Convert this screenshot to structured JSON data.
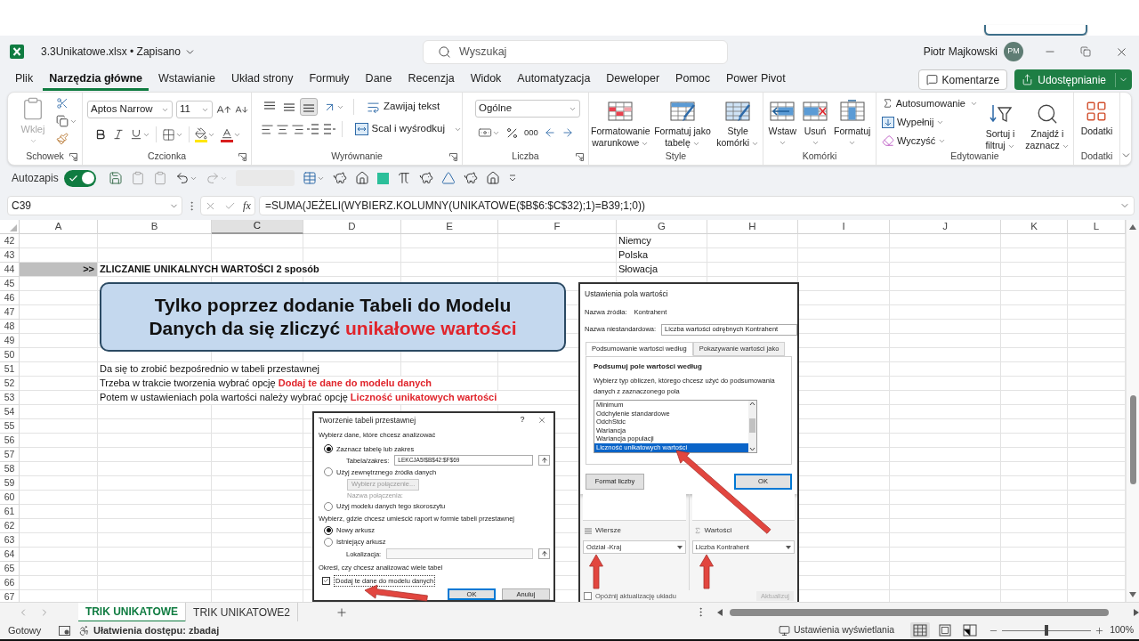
{
  "window": {
    "title": "3.3Unikatowe.xlsx • Zapisano",
    "user_name": "Piotr Majkowski",
    "user_initials": "PM"
  },
  "search": {
    "placeholder": "Wyszukaj"
  },
  "menu_tabs": [
    {
      "label": "Plik",
      "selected": false
    },
    {
      "label": "Narzędzia główne",
      "selected": true
    },
    {
      "label": "Wstawianie",
      "selected": false
    },
    {
      "label": "Układ strony",
      "selected": false
    },
    {
      "label": "Formuły",
      "selected": false
    },
    {
      "label": "Dane",
      "selected": false
    },
    {
      "label": "Recenzja",
      "selected": false
    },
    {
      "label": "Widok",
      "selected": false
    },
    {
      "label": "Automatyzacja",
      "selected": false
    },
    {
      "label": "Deweloper",
      "selected": false
    },
    {
      "label": "Pomoc",
      "selected": false
    },
    {
      "label": "Power Pivot",
      "selected": false
    }
  ],
  "header_buttons": {
    "comments": "Komentarze",
    "share": "Udostępnianie"
  },
  "ribbon": {
    "clipboard": {
      "title": "Schowek",
      "paste": "Wklej",
      "paste_disabled": true
    },
    "font": {
      "title": "Czcionka",
      "family": "Aptos Narrow",
      "size": "11"
    },
    "alignment": {
      "title": "Wyrównanie",
      "wrap_text": "Zawijaj tekst",
      "merge": "Scal i wyśrodkuj"
    },
    "number": {
      "title": "Liczba",
      "format": "Ogólne",
      "thousands": "000"
    },
    "styles": {
      "title": "Style",
      "buttons": [
        "Formatowanie warunkowe",
        "Formatuj jako tabelę",
        "Style komórki"
      ]
    },
    "cells": {
      "title": "Komórki",
      "buttons": [
        "Wstaw",
        "Usuń",
        "Formatuj"
      ]
    },
    "editing": {
      "title": "Edytowanie",
      "autosum": "Autosumowanie",
      "fill": "Wypełnij",
      "clear": "Wyczyść",
      "sort_filter": "Sortuj i filtruj",
      "find_select": "Znajdź i zaznacz"
    },
    "addins": {
      "title": "Dodatki",
      "button": "Dodatki"
    }
  },
  "quick_access": {
    "autosave_label": "Autozapis",
    "autosave_on": true
  },
  "formula_bar": {
    "cell_reference": "C39",
    "function_label": "fx",
    "formula": "=SUMA(JEŻELI(WYBIERZ.KOLUMNY(UNIKATOWE($B$6:$C$32);1)=B39;1;0))"
  },
  "columns": [
    {
      "label": "A",
      "selected": false
    },
    {
      "label": "B",
      "selected": false
    },
    {
      "label": "C",
      "selected": true
    },
    {
      "label": "D",
      "selected": false
    },
    {
      "label": "E",
      "selected": false
    },
    {
      "label": "F",
      "selected": false
    },
    {
      "label": "G",
      "selected": false
    },
    {
      "label": "H",
      "selected": false
    },
    {
      "label": "I",
      "selected": false
    },
    {
      "label": "J",
      "selected": false
    },
    {
      "label": "K",
      "selected": false
    },
    {
      "label": "L",
      "selected": false
    }
  ],
  "rows": [
    {
      "number": "42",
      "cells": {
        "g": {
          "kind": "text",
          "text": "Niemcy"
        }
      }
    },
    {
      "number": "43",
      "cells": {
        "g": {
          "kind": "text",
          "text": "Polska"
        }
      }
    },
    {
      "number": "44",
      "cells": {
        "a": {
          "kind": "marker",
          "text": ">>"
        },
        "b": {
          "kind": "heading",
          "text": "ZLICZANIE UNIKALNYCH WARTOŚCI 2 sposób"
        },
        "g": {
          "kind": "text",
          "text": "Słowacja"
        }
      }
    },
    {
      "number": "45"
    },
    {
      "number": "46"
    },
    {
      "number": "47"
    },
    {
      "number": "48"
    },
    {
      "number": "49"
    },
    {
      "number": "50"
    },
    {
      "number": "51",
      "cells": {
        "b": {
          "kind": "text",
          "text": "Da się to zrobić bezpośrednio w tabeli przestawnej"
        }
      }
    },
    {
      "number": "52",
      "cells": {
        "b": {
          "kind": "text",
          "text": "Trzeba w trakcie tworzenia wybrać opcję ",
          "emphasis": "Dodaj te dane do modelu danych"
        }
      }
    },
    {
      "number": "53",
      "cells": {
        "b": {
          "kind": "text",
          "text": "Potem w ustawieniach pola wartości należy wybrać opcję ",
          "emphasis": "Liczność unikatowych wartości"
        }
      }
    },
    {
      "number": "54"
    },
    {
      "number": "55"
    },
    {
      "number": "56"
    },
    {
      "number": "57"
    },
    {
      "number": "58"
    },
    {
      "number": "59"
    },
    {
      "number": "60"
    },
    {
      "number": "61"
    },
    {
      "number": "62"
    },
    {
      "number": "63"
    },
    {
      "number": "64"
    },
    {
      "number": "65"
    },
    {
      "number": "66"
    },
    {
      "number": "67"
    }
  ],
  "callout": {
    "text": "Tylko poprzez dodanie Tabeli do Modelu Danych da się zliczyć ",
    "emphasis": "unikałowe wartości"
  },
  "pivot_dialog": {
    "title": "Tworzenie tabeli przestawnej",
    "help": "?",
    "source_heading": "Wybierz dane, które chcesz analizować",
    "source_options": [
      {
        "label": "Zaznacz tabelę lub zakres",
        "selected": true
      },
      {
        "label": "Użyj zewnętrznego źródła danych",
        "selected": false
      },
      {
        "label": "Użyj modelu danych tego skoroszytu",
        "selected": false
      }
    ],
    "range_label": "Tabela/zakres:",
    "range_value": "LEKCJA5!$B$42:$F$69",
    "connection_button": "Wybierz połączenie...",
    "connection_label": "Nazwa połączenia:",
    "location_heading": "Wybierz, gdzie chcesz umieścić raport w formie tabeli przestawnej",
    "location_options": [
      {
        "label": "Nowy arkusz",
        "selected": true
      },
      {
        "label": "Istniejący arkusz",
        "selected": false
      }
    ],
    "location_label": "Lokalizacja:",
    "multi_heading": "Określ, czy chcesz analizować wiele tabel",
    "data_model": {
      "label": "Dodaj te dane do modelu danych",
      "checked": true
    },
    "buttons": [
      "OK",
      "Anuluj"
    ]
  },
  "value_field_dialog": {
    "title": "Ustawienia pola wartości",
    "source_label": "Nazwa źródła:",
    "source_value": "Kontrahent",
    "custom_name_label": "Nazwa niestandardowa:",
    "custom_name_value": "Liczba wartości odrębnych Kontrahent",
    "tabs": [
      {
        "label": "Podsumowanie wartości według",
        "selected": true
      },
      {
        "label": "Pokazywanie wartości jako",
        "selected": false
      }
    ],
    "section_title": "Podsumuj pole wartości według",
    "description": "Wybierz typ obliczeń, którego chcesz użyć do podsumowania danych z zaznaczonego pola",
    "functions": [
      {
        "label": "Minimum",
        "selected": false
      },
      {
        "label": "Odchylenie standardowe",
        "selected": false
      },
      {
        "label": "OdchStdc",
        "selected": false
      },
      {
        "label": "Wariancja",
        "selected": false
      },
      {
        "label": "Wariancja populacji",
        "selected": false
      },
      {
        "label": "Liczność unikatowych wartości",
        "selected": true
      }
    ],
    "number_format_button": "Format liczby",
    "ok_button": "OK"
  },
  "pivot_fields": {
    "rows_label": "Wiersze",
    "rows_field": "Odział -Kraj",
    "values_label": "Wartości",
    "values_field": "Liczba Kontrahent",
    "defer": {
      "label": "Opóźnij aktualizację układu",
      "checked": false
    },
    "update_button": "Aktualizuj"
  },
  "sheet_tabs": [
    {
      "label": "TRIK UNIKATOWE",
      "selected": true
    },
    {
      "label": "TRIK UNIKATOWE2",
      "selected": false
    }
  ],
  "status_bar": {
    "state": "Gotowy",
    "accessibility": "Ułatwienia dostępu: zbadaj",
    "display_settings": "Ustawienia wyświetlania",
    "views": [
      {
        "kind": "normal",
        "selected": true
      },
      {
        "kind": "page_layout",
        "selected": false
      },
      {
        "kind": "page_break",
        "selected": false
      }
    ],
    "zoom": {
      "level": 0.5,
      "reading": "100%"
    }
  }
}
